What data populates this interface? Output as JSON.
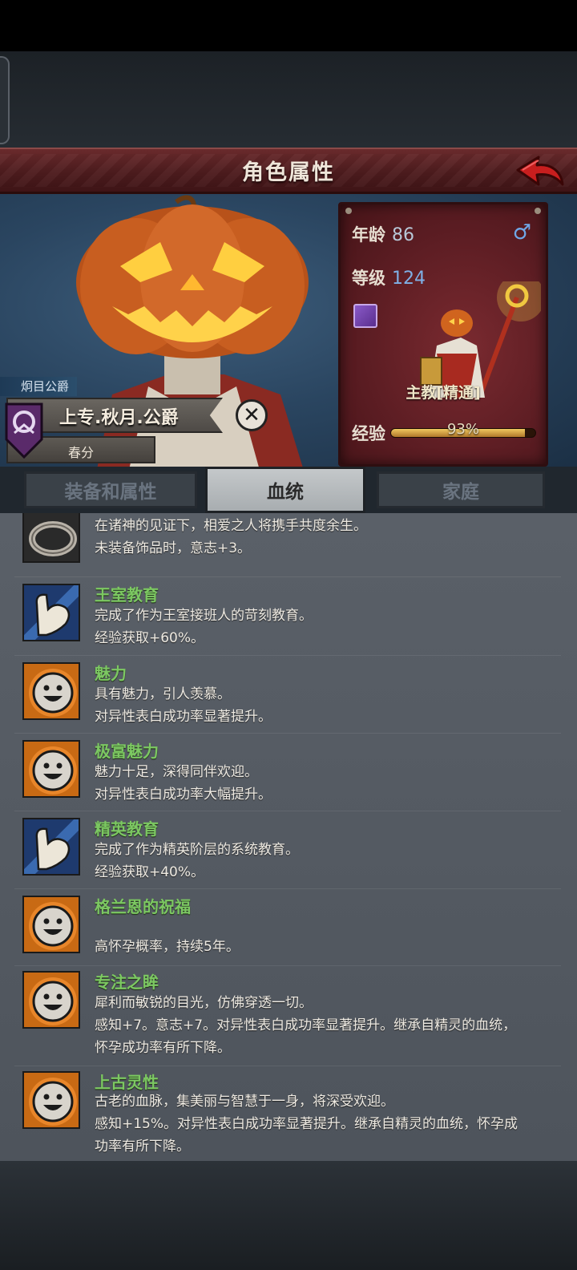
{
  "header": {
    "title": "角色属性"
  },
  "stats": {
    "age_label": "年龄",
    "age_value": "86",
    "level_label": "等级",
    "level_value": "124",
    "gender_symbol": "♂",
    "class_label": "主教[精通]",
    "exp_label": "经验",
    "exp_percent": "93%",
    "exp_fraction": 0.93
  },
  "title_plate": {
    "rank_tag": "炯目公爵",
    "name": "上专.秋月.公爵",
    "season": "春分"
  },
  "tabs": [
    {
      "label": "装备和属性"
    },
    {
      "label": "血统"
    },
    {
      "label": "家庭"
    }
  ],
  "traits": [
    {
      "name": "",
      "icon": "ring-icon",
      "desc1": "在诸神的见证下，相爱之人将携手共度余生。",
      "desc2": "未装备饰品时，意志+3。"
    },
    {
      "name": "王室教育",
      "icon": "muscle-arm-icon",
      "desc1": "完成了作为王室接班人的苛刻教育。",
      "desc2": "经验获取+60%。"
    },
    {
      "name": "魅力",
      "icon": "smiley-face-icon",
      "desc1": "具有魅力，引人羡慕。",
      "desc2": "对异性表白成功率显著提升。"
    },
    {
      "name": "极富魅力",
      "icon": "smiley-face-icon",
      "desc1": "魅力十足，深得同伴欢迎。",
      "desc2": "对异性表白成功率大幅提升。"
    },
    {
      "name": "精英教育",
      "icon": "muscle-arm-icon",
      "desc1": "完成了作为精英阶层的系统教育。",
      "desc2": "经验获取+40%。"
    },
    {
      "name": "格兰恩的祝福",
      "icon": "smiley-face-icon",
      "desc1": "",
      "desc2": "高怀孕概率，持续5年。"
    },
    {
      "name": "专注之眸",
      "icon": "smiley-face-icon",
      "desc1": "犀利而敏锐的目光，仿佛穿透一切。",
      "desc2": "感知+7。意志+7。对异性表白成功率显著提升。继承自精灵的血统，",
      "desc3": "怀孕成功率有所下降。"
    },
    {
      "name": "上古灵性",
      "icon": "smiley-face-icon",
      "desc1": "古老的血脉，集美丽与智慧于一身，将深受欢迎。",
      "desc2": "感知+15%。对异性表白成功率显著提升。继承自精灵的血统，怀孕成",
      "desc3": "功率有所下降。"
    }
  ]
}
